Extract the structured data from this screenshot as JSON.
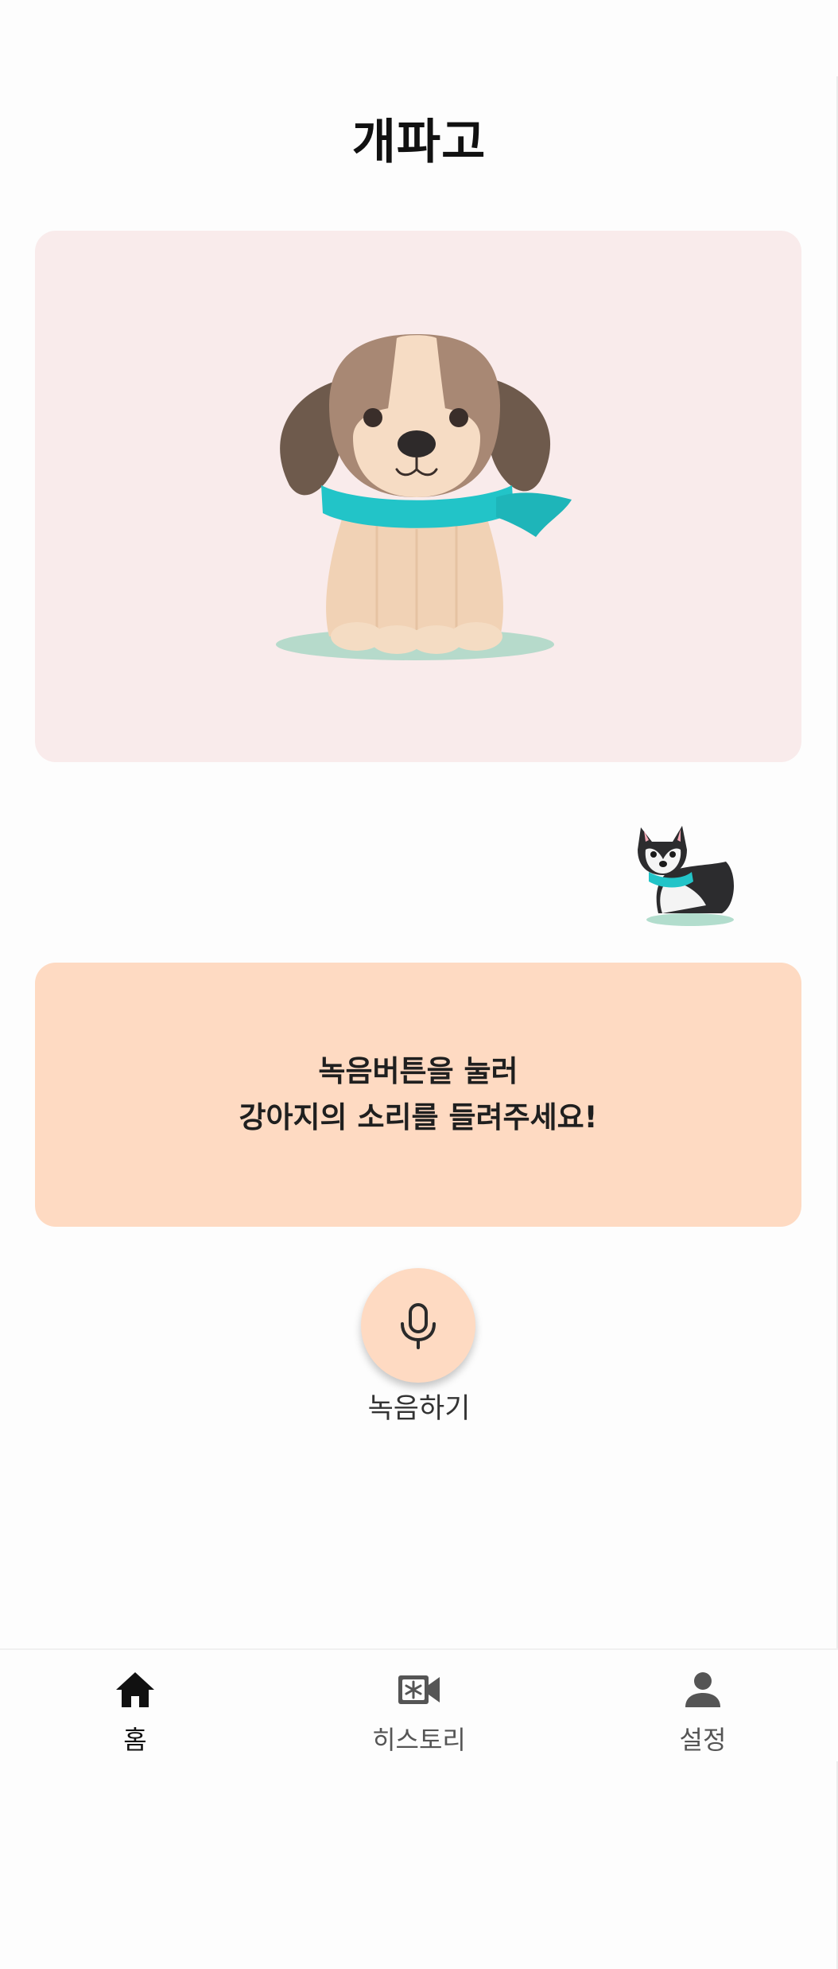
{
  "app": {
    "title": "개파고"
  },
  "hero": {
    "image_icon": "sitting-puppy-with-teal-scarf-illustration"
  },
  "mascot": {
    "image_icon": "husky-puppy-mascot-illustration"
  },
  "message": {
    "line1": "녹음버튼을 눌러",
    "line2": "강아지의 소리를 들려주세요!"
  },
  "record": {
    "icon": "microphone-icon",
    "label": "녹음하기"
  },
  "nav": {
    "items": [
      {
        "label": "홈",
        "icon": "home-icon",
        "active": true
      },
      {
        "label": "히스토리",
        "icon": "video-history-icon",
        "active": false
      },
      {
        "label": "설정",
        "icon": "person-icon",
        "active": false
      }
    ]
  },
  "colors": {
    "hero_bg": "#f9ebeb",
    "accent_peach": "#fedac2",
    "scarf_teal": "#22c4c8",
    "nav_active": "#111111",
    "nav_inactive": "#555555"
  }
}
